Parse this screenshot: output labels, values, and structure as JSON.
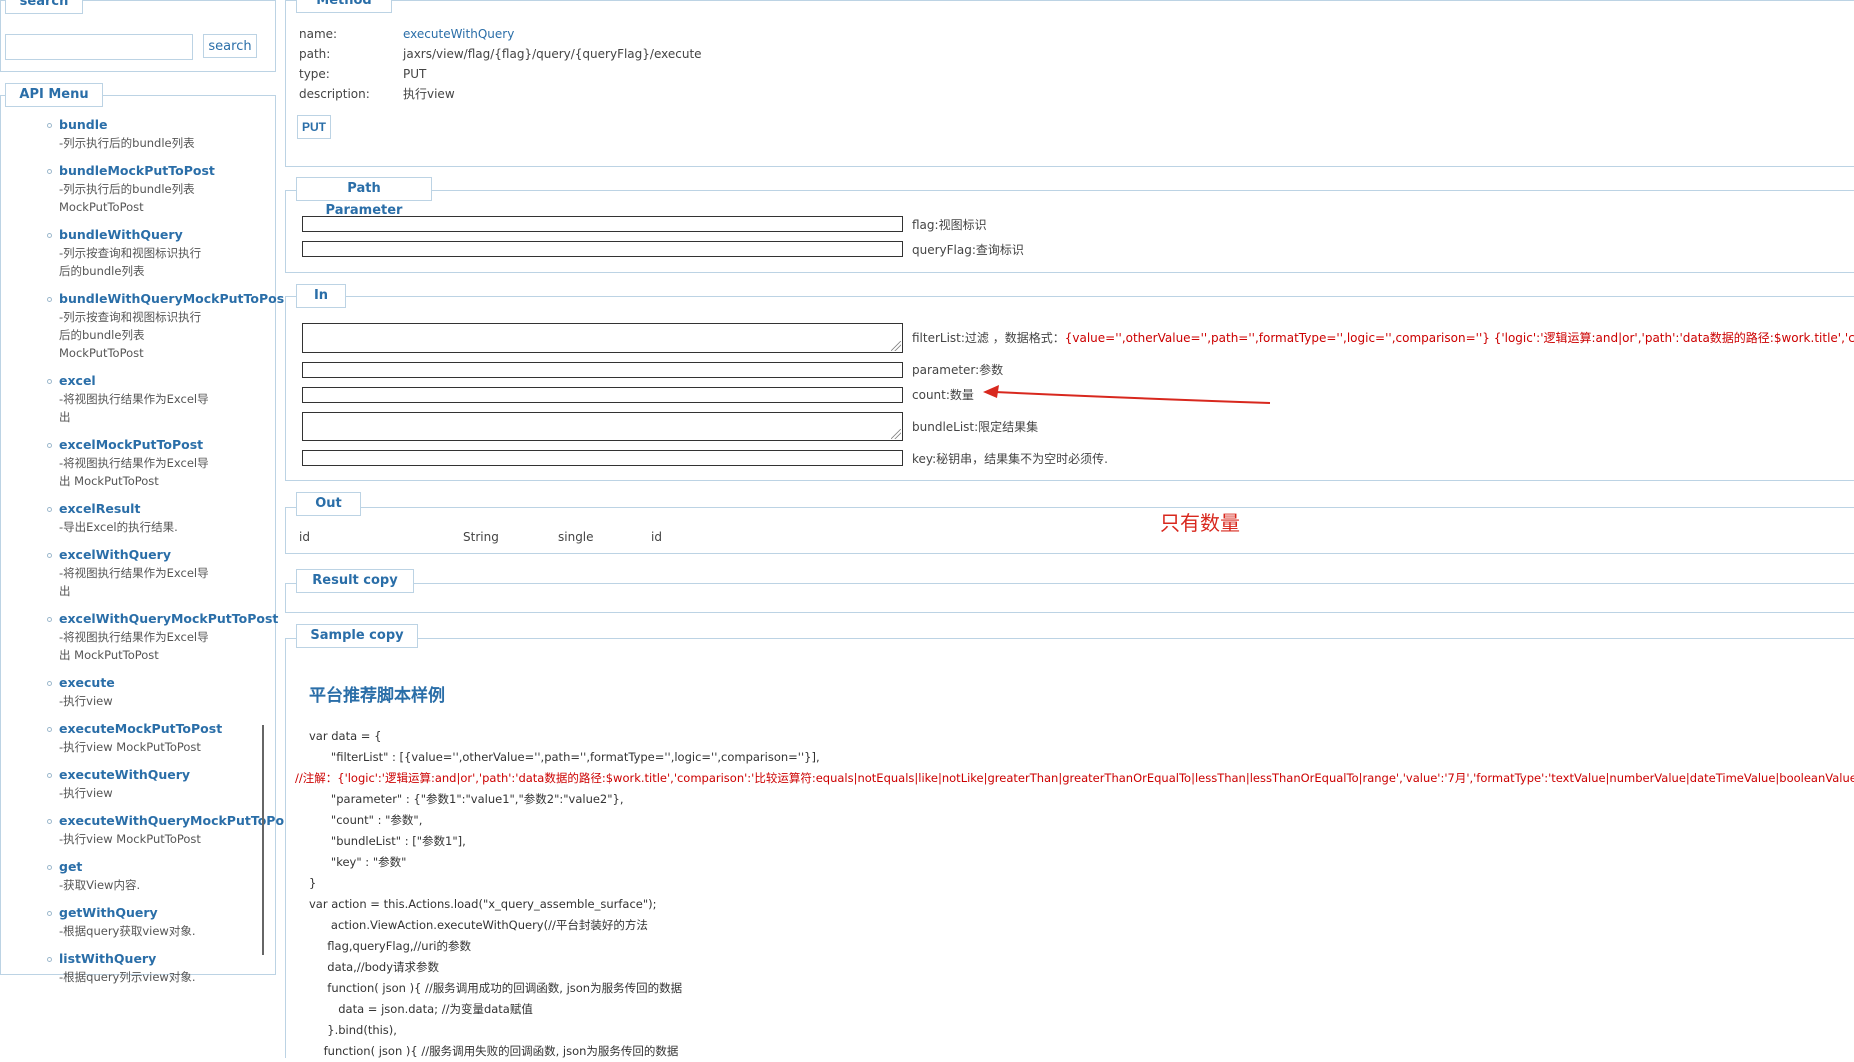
{
  "search": {
    "legend": "search",
    "input_value": "",
    "button_label": "search"
  },
  "api_menu": {
    "legend": "API Menu",
    "items": [
      {
        "name": "bundle",
        "desc": "-列示执行后的bundle列表"
      },
      {
        "name": "bundleMockPutToPost",
        "desc": "-列示执行后的bundle列表 MockPutToPost"
      },
      {
        "name": "bundleWithQuery",
        "desc": "-列示按查询和视图标识执行后的bundle列表"
      },
      {
        "name": "bundleWithQueryMockPutToPost",
        "desc": "-列示按查询和视图标识执行后的bundle列表 MockPutToPost"
      },
      {
        "name": "excel",
        "desc": "-将视图执行结果作为Excel导出"
      },
      {
        "name": "excelMockPutToPost",
        "desc": "-将视图执行结果作为Excel导出 MockPutToPost"
      },
      {
        "name": "excelResult",
        "desc": "-导出Excel的执行结果."
      },
      {
        "name": "excelWithQuery",
        "desc": "-将视图执行结果作为Excel导出"
      },
      {
        "name": "excelWithQueryMockPutToPost",
        "desc": "-将视图执行结果作为Excel导出 MockPutToPost"
      },
      {
        "name": "execute",
        "desc": "-执行view"
      },
      {
        "name": "executeMockPutToPost",
        "desc": "-执行view MockPutToPost"
      },
      {
        "name": "executeWithQuery",
        "desc": "-执行view"
      },
      {
        "name": "executeWithQueryMockPutToPost",
        "desc": "-执行view MockPutToPost"
      },
      {
        "name": "get",
        "desc": "-获取View内容."
      },
      {
        "name": "getWithQuery",
        "desc": "-根据query获取view对象."
      },
      {
        "name": "listWithQuery",
        "desc": "-根据query列示view对象."
      }
    ]
  },
  "method": {
    "legend": "Method",
    "name_key": "name:",
    "name_value": "executeWithQuery",
    "path_key": "path:",
    "path_value": "jaxrs/view/flag/{flag}/query/{queryFlag}/execute",
    "type_key": "type:",
    "type_value": "PUT",
    "description_key": "description:",
    "description_value": "执行view",
    "button_label": "PUT"
  },
  "path_parameter": {
    "legend": "Path Parameter",
    "fields": [
      {
        "label": "flag:视图标识"
      },
      {
        "label": "queryFlag:查询标识"
      }
    ]
  },
  "in": {
    "legend": "In",
    "filter_label": "filterList:过滤 ，数据格式：",
    "filter_format": "{value='',otherValue='',path='',formatType='',logic='',comparison=''} {'logic':'逻辑运算:and|or','path':'data数据的路径:$work.title','comparison':'比较运算符",
    "parameter_label": "parameter:参数",
    "count_label": "count:数量",
    "bundle_label": "bundleList:限定结果集",
    "key_label": "key:秘钥串，结果集不为空时必须传."
  },
  "out": {
    "legend": "Out",
    "row": [
      "id",
      "String",
      "single",
      "id"
    ]
  },
  "annotation_text": "只有数量",
  "result_copy": {
    "legend": "Result copy"
  },
  "sample_copy": {
    "legend": "Sample copy",
    "title": "平台推荐脚本样例",
    "code_lines": [
      "var data = {",
      "      \"filterList\" : [{value='',otherValue='',path='',formatType='',logic='',comparison=''}],",
      "",
      "      \"parameter\" : {\"参数1\":\"value1\",\"参数2\":\"value2\"},",
      "      \"count\" : \"参数\",",
      "      \"bundleList\" : [\"参数1\"],",
      "      \"key\" : \"参数\"",
      "}",
      "var action = this.Actions.load(\"x_query_assemble_surface\");",
      "      action.ViewAction.executeWithQuery(//平台封装好的方法",
      "     flag,queryFlag,//uri的参数",
      "     data,//body请求参数",
      "     function( json ){ //服务调用成功的回调函数, json为服务传回的数据",
      "        data = json.data; //为变量data赋值",
      "     }.bind(this),",
      "    function( json ){ //服务调用失败的回调函数, json为服务传回的数据"
    ],
    "comment_line": "//注解：{'logic':'逻辑运算:and|or','path':'data数据的路径:$work.title','comparison':'比较运算符:equals|notEquals|like|notLike|greaterThan|greaterThanOrEqualTo|lessThan|lessThanOrEqualTo|range','value':'7月','formatType':'textValue|numberValue|dateTimeValue|booleanValue'}"
  },
  "colors": {
    "accent": "#2a6ea8",
    "border": "#bcd3e4",
    "annotation_red": "#d8281e"
  }
}
